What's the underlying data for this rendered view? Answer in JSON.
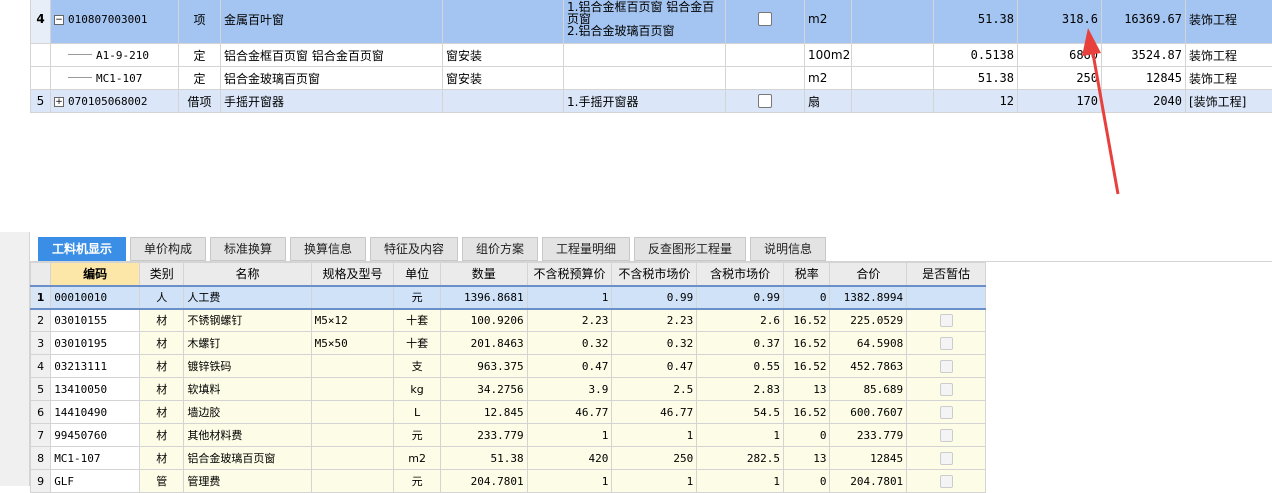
{
  "top_rows": [
    {
      "no": "4",
      "code": "010807003001",
      "type": "项",
      "name": "金属百叶窗",
      "content": "",
      "features": [
        "1.铝合金框百页窗 铝合金百页窗",
        "2.铝合金玻璃百页窗"
      ],
      "unit": "m2",
      "qty": "51.38",
      "price": "318.6",
      "total": "16369.67",
      "category": "装饰工程"
    },
    {
      "no": "",
      "code": "A1-9-210",
      "type": "定",
      "name": "铝合金框百页窗 铝合金百页窗",
      "content": "窗安装",
      "features": [],
      "unit": "100m2",
      "qty": "0.5138",
      "price": "6860",
      "total": "3524.87",
      "category": "装饰工程"
    },
    {
      "no": "",
      "code": "MC1-107",
      "type": "定",
      "name": "铝合金玻璃百页窗",
      "content": "窗安装",
      "features": [],
      "unit": "m2",
      "qty": "51.38",
      "price": "250",
      "total": "12845",
      "category": "装饰工程"
    },
    {
      "no": "5",
      "code": "070105068002",
      "type": "借项",
      "name": "手摇开窗器",
      "content": "",
      "features": [
        "1.手摇开窗器"
      ],
      "unit": "扇",
      "qty": "12",
      "price": "170",
      "total": "2040",
      "category": "[装饰工程]"
    }
  ],
  "tabs": [
    "工料机显示",
    "单价构成",
    "标准换算",
    "换算信息",
    "特征及内容",
    "组价方案",
    "工程量明细",
    "反查图形工程量",
    "说明信息"
  ],
  "headers": [
    "编码",
    "类别",
    "名称",
    "规格及型号",
    "单位",
    "数量",
    "不含税预算价",
    "不含税市场价",
    "含税市场价",
    "税率",
    "合价",
    "是否暂估"
  ],
  "rows": [
    {
      "n": "1",
      "code": "00010010",
      "cat": "人",
      "name": "人工费",
      "spec": "",
      "unit": "元",
      "qty": "1396.8681",
      "p1": "1",
      "p2": "0.99",
      "p3": "0.99",
      "tax": "0",
      "sum": "1382.8994"
    },
    {
      "n": "2",
      "code": "03010155",
      "cat": "材",
      "name": "不锈钢螺钉",
      "spec": "M5×12",
      "unit": "十套",
      "qty": "100.9206",
      "p1": "2.23",
      "p2": "2.23",
      "p3": "2.6",
      "tax": "16.52",
      "sum": "225.0529"
    },
    {
      "n": "3",
      "code": "03010195",
      "cat": "材",
      "name": "木螺钉",
      "spec": "M5×50",
      "unit": "十套",
      "qty": "201.8463",
      "p1": "0.32",
      "p2": "0.32",
      "p3": "0.37",
      "tax": "16.52",
      "sum": "64.5908"
    },
    {
      "n": "4",
      "code": "03213111",
      "cat": "材",
      "name": "镀锌铁码",
      "spec": "",
      "unit": "支",
      "qty": "963.375",
      "p1": "0.47",
      "p2": "0.47",
      "p3": "0.55",
      "tax": "16.52",
      "sum": "452.7863"
    },
    {
      "n": "5",
      "code": "13410050",
      "cat": "材",
      "name": "软填料",
      "spec": "",
      "unit": "kg",
      "qty": "34.2756",
      "p1": "3.9",
      "p2": "2.5",
      "p3": "2.83",
      "tax": "13",
      "sum": "85.689"
    },
    {
      "n": "6",
      "code": "14410490",
      "cat": "材",
      "name": "墙边胶",
      "spec": "",
      "unit": "L",
      "qty": "12.845",
      "p1": "46.77",
      "p2": "46.77",
      "p3": "54.5",
      "tax": "16.52",
      "sum": "600.7607"
    },
    {
      "n": "7",
      "code": "99450760",
      "cat": "材",
      "name": "其他材料费",
      "spec": "",
      "unit": "元",
      "qty": "233.779",
      "p1": "1",
      "p2": "1",
      "p3": "1",
      "tax": "0",
      "sum": "233.779"
    },
    {
      "n": "8",
      "code": "MC1-107",
      "cat": "材",
      "name": "铝合金玻璃百页窗",
      "spec": "",
      "unit": "m2",
      "qty": "51.38",
      "p1": "420",
      "p2": "250",
      "p3": "282.5",
      "tax": "13",
      "sum": "12845"
    },
    {
      "n": "9",
      "code": "GLF",
      "cat": "管",
      "name": "管理费",
      "spec": "",
      "unit": "元",
      "qty": "204.7801",
      "p1": "1",
      "p2": "1",
      "p3": "1",
      "tax": "0",
      "sum": "204.7801"
    }
  ],
  "colors": {
    "selected_row": "#a4c5f1",
    "tab_active": "#3b8ee6",
    "annotation_arrow": "#e8403c"
  }
}
